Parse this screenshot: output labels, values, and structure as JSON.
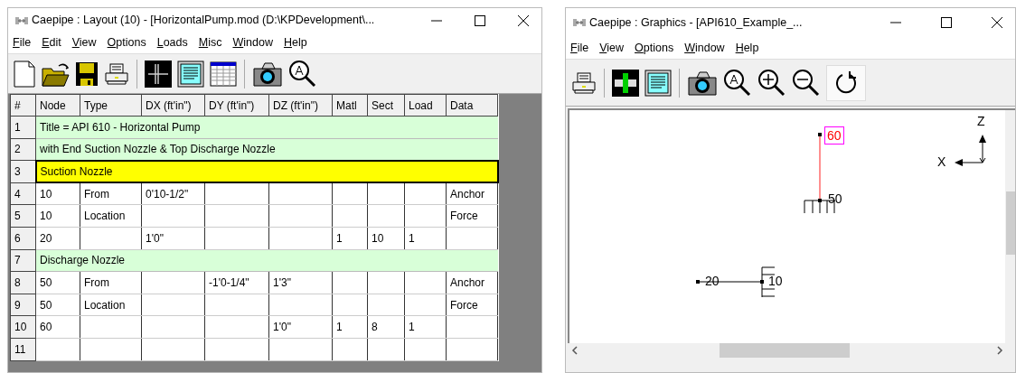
{
  "layout_window": {
    "title": "Caepipe : Layout  (10)  -  [HorizontalPump.mod (D:\\KPDevelopment\\...",
    "menu": [
      "File",
      "Edit",
      "View",
      "Options",
      "Loads",
      "Misc",
      "Window",
      "Help"
    ],
    "toolbar": [
      {
        "kind": "new"
      },
      {
        "kind": "open"
      },
      {
        "kind": "save"
      },
      {
        "kind": "print"
      },
      {
        "kind": "sep"
      },
      {
        "kind": "grid"
      },
      {
        "kind": "text"
      },
      {
        "kind": "table"
      },
      {
        "kind": "sep"
      },
      {
        "kind": "camera"
      },
      {
        "kind": "zoomall"
      }
    ],
    "table": {
      "columns": [
        "#",
        "Node",
        "Type",
        "DX (ft'in\")",
        "DY (ft'in\")",
        "DZ (ft'in\")",
        "Matl",
        "Sect",
        "Load",
        "Data"
      ],
      "rows": [
        {
          "number": "1",
          "kind": "comment",
          "selected": false,
          "text": "Title = API 610 - Horizontal Pump"
        },
        {
          "number": "2",
          "kind": "comment",
          "selected": false,
          "text": "with End Suction Nozzle & Top Discharge Nozzle"
        },
        {
          "number": "3",
          "kind": "comment",
          "selected": true,
          "text": "Suction Nozzle"
        },
        {
          "number": "4",
          "kind": "data",
          "selected": false,
          "cells": {
            "node": "10",
            "type": "From",
            "dx": "0'10-1/2\"",
            "data": "Anchor"
          }
        },
        {
          "number": "5",
          "kind": "data",
          "selected": false,
          "cells": {
            "node": "10",
            "type": "Location",
            "data": "Force"
          }
        },
        {
          "number": "6",
          "kind": "data",
          "selected": false,
          "cells": {
            "node": "20",
            "dx": "1'0\"",
            "matl": "1",
            "sect": "10",
            "load": "1"
          }
        },
        {
          "number": "7",
          "kind": "comment",
          "selected": false,
          "text": "Discharge Nozzle"
        },
        {
          "number": "8",
          "kind": "data",
          "selected": false,
          "cells": {
            "node": "50",
            "type": "From",
            "dy": "-1'0-1/4\"",
            "dz": "1'3\"",
            "data": "Anchor"
          }
        },
        {
          "number": "9",
          "kind": "data",
          "selected": false,
          "cells": {
            "node": "50",
            "type": "Location",
            "data": "Force"
          }
        },
        {
          "number": "10",
          "kind": "data",
          "selected": false,
          "cells": {
            "node": "60",
            "dz": "1'0\"",
            "matl": "1",
            "sect": "8",
            "load": "1"
          }
        },
        {
          "number": "11",
          "kind": "data",
          "selected": false,
          "cells": {}
        }
      ]
    }
  },
  "graphics_window": {
    "title": "Caepipe : Graphics -  [API610_Example_...",
    "menu": [
      "File",
      "View",
      "Options",
      "Window",
      "Help"
    ],
    "toolbar": [
      {
        "kind": "print",
        "on": false
      },
      {
        "kind": "sep"
      },
      {
        "kind": "pipe",
        "on": false
      },
      {
        "kind": "text",
        "on": false
      },
      {
        "kind": "sep"
      },
      {
        "kind": "camera",
        "on": false
      },
      {
        "kind": "zoomall",
        "on": false
      },
      {
        "kind": "zoomin",
        "on": false
      },
      {
        "kind": "zoomout",
        "on": false
      },
      {
        "kind": "rotate",
        "on": true
      }
    ],
    "nodes": [
      {
        "label": "60",
        "selected": true
      },
      {
        "label": "50",
        "selected": false
      },
      {
        "label": "20",
        "selected": false
      },
      {
        "label": "10",
        "selected": false
      }
    ],
    "axes": [
      "Z",
      "X"
    ]
  }
}
